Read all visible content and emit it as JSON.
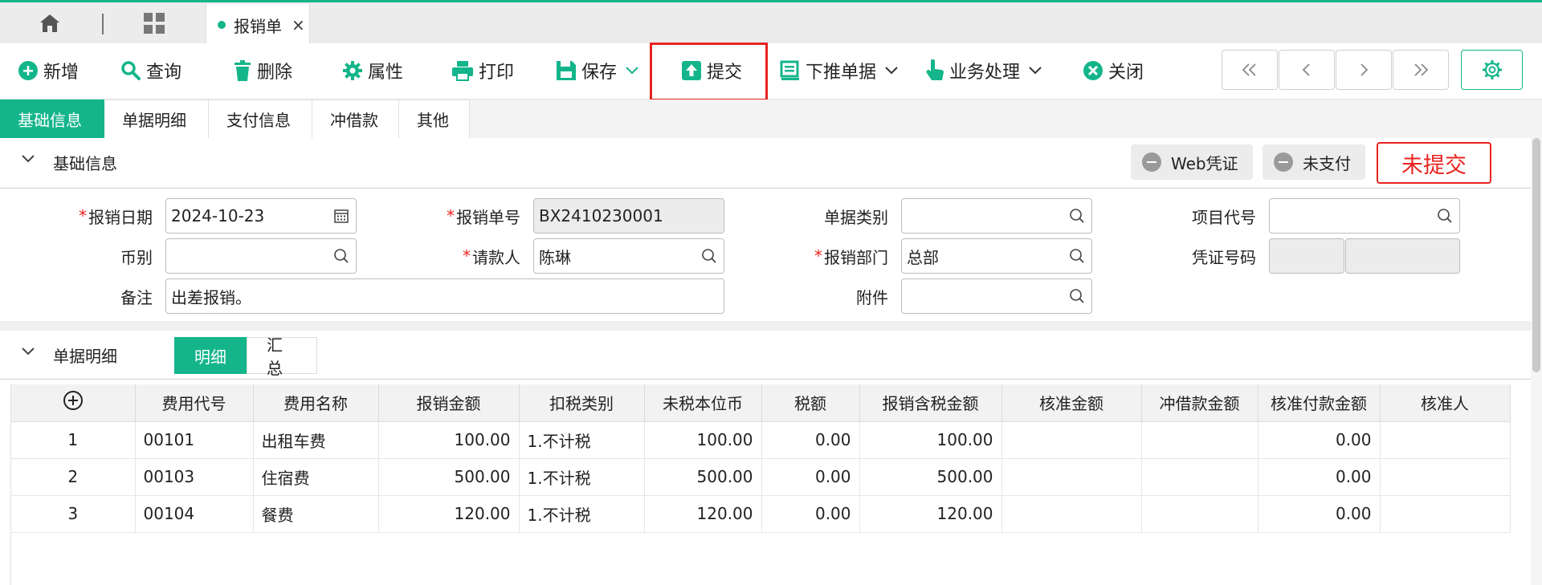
{
  "tabs": {
    "doc_title": "报销单",
    "close": "×"
  },
  "toolbar": {
    "new": "新增",
    "query": "查询",
    "delete": "删除",
    "attributes": "属性",
    "print": "打印",
    "save": "保存",
    "submit": "提交",
    "push_down": "下推单据",
    "business": "业务处理",
    "close": "关闭"
  },
  "nav": {
    "first": "«",
    "prev": "‹",
    "next": "›",
    "last": "»"
  },
  "section_tabs": [
    "基础信息",
    "单据明细",
    "支付信息",
    "冲借款",
    "其他"
  ],
  "basic": {
    "title": "基础信息",
    "web_voucher": "Web凭证",
    "unpaid": "未支付",
    "status": "未提交"
  },
  "form": {
    "req": "*",
    "date_label": "报销日期",
    "date_value": "2024-10-23",
    "no_label": "报销单号",
    "no_value": "BX2410230001",
    "category_label": "单据类别",
    "category_value": "",
    "project_label": "项目代号",
    "project_value": "",
    "currency_label": "币别",
    "currency_value": "",
    "requester_label": "请款人",
    "requester_value": "陈琳",
    "dept_label": "报销部门",
    "dept_value": "总部",
    "voucher_label": "凭证号码",
    "remark_label": "备注",
    "remark_value": "出差报销。",
    "attachment_label": "附件",
    "attachment_value": ""
  },
  "detail": {
    "title": "单据明细",
    "seg_detail": "明细",
    "seg_summary": "汇总",
    "columns": [
      "费用代号",
      "费用名称",
      "报销金额",
      "扣税类别",
      "未税本位币",
      "税额",
      "报销含税金额",
      "核准金额",
      "冲借款金额",
      "核准付款金额",
      "核准人"
    ],
    "rows": [
      [
        "1",
        "00101",
        "出租车费",
        "100.00",
        "1.不计税",
        "100.00",
        "0.00",
        "100.00",
        "",
        "",
        "0.00",
        ""
      ],
      [
        "2",
        "00103",
        "住宿费",
        "500.00",
        "1.不计税",
        "500.00",
        "0.00",
        "500.00",
        "",
        "",
        "0.00",
        ""
      ],
      [
        "3",
        "00104",
        "餐费",
        "120.00",
        "1.不计税",
        "120.00",
        "0.00",
        "120.00",
        "",
        "",
        "0.00",
        ""
      ]
    ]
  },
  "colors": {
    "accent": "#14b58b",
    "alert": "#e8231f"
  }
}
